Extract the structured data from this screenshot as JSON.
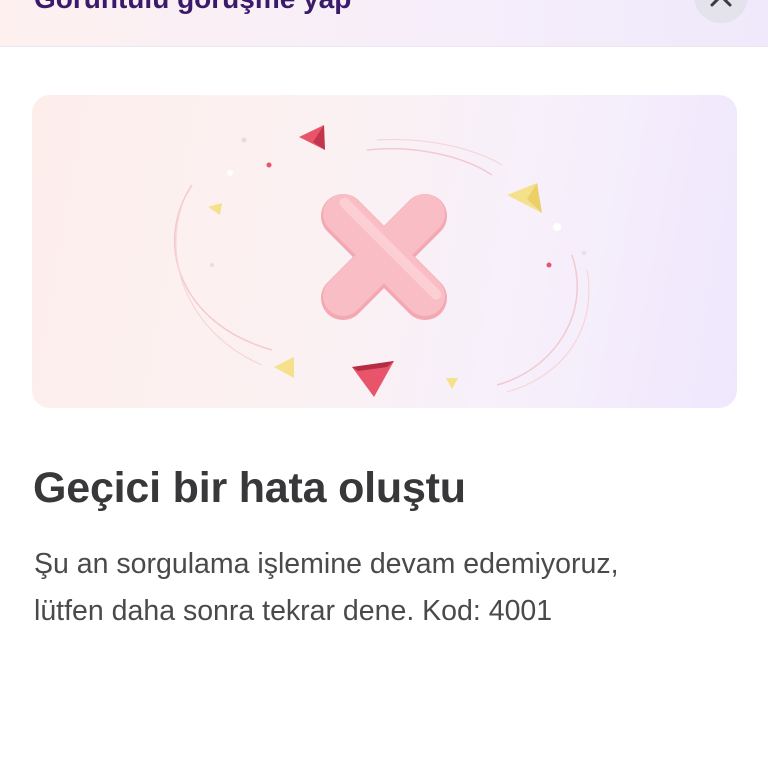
{
  "header": {
    "title": "Görüntülü görüşme yap",
    "close_icon": "close-icon"
  },
  "illustration": {
    "icon": "error-x-icon"
  },
  "error": {
    "title": "Geçici bir hata oluştu",
    "message_line1": "Şu an sorgulama işlemine devam edemiyoruz,",
    "message_line2": "lütfen daha sonra tekrar dene. Kod: 4001"
  },
  "colors": {
    "header_text": "#3a1a6b",
    "title_text": "#38383a",
    "body_text": "#4a4a4c",
    "x_fill": "#f9bec5",
    "accent_red": "#e8556a",
    "accent_yellow": "#f5e08c"
  }
}
